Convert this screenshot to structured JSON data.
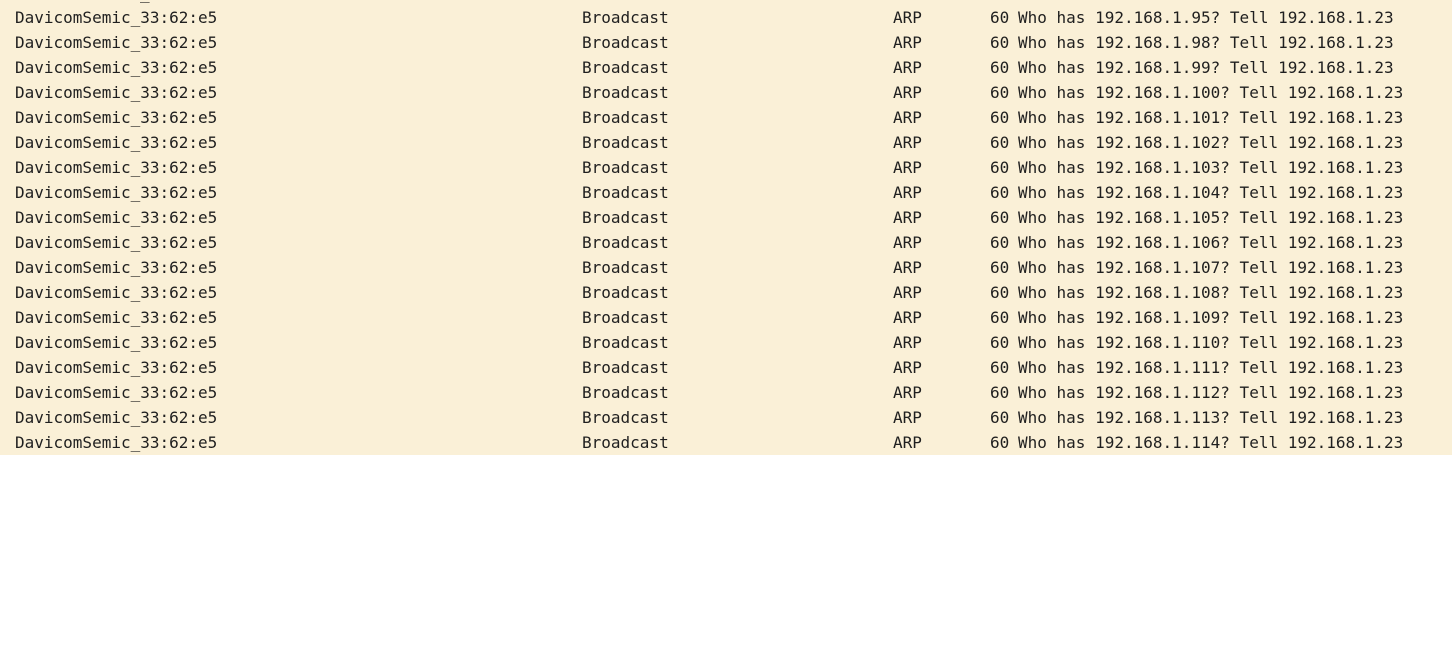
{
  "colors": {
    "arp_row_bg": "#faf0d7",
    "text": "#1f1f1f",
    "page_bg": "#ffffff"
  },
  "top_partial_glyph": "_",
  "packets": [
    {
      "source": "DavicomSemic_33:62:e5",
      "destination": "Broadcast",
      "protocol": "ARP",
      "length": "60",
      "info": "Who has 192.168.1.95? Tell 192.168.1.23"
    },
    {
      "source": "DavicomSemic_33:62:e5",
      "destination": "Broadcast",
      "protocol": "ARP",
      "length": "60",
      "info": "Who has 192.168.1.98? Tell 192.168.1.23"
    },
    {
      "source": "DavicomSemic_33:62:e5",
      "destination": "Broadcast",
      "protocol": "ARP",
      "length": "60",
      "info": "Who has 192.168.1.99? Tell 192.168.1.23"
    },
    {
      "source": "DavicomSemic_33:62:e5",
      "destination": "Broadcast",
      "protocol": "ARP",
      "length": "60",
      "info": "Who has 192.168.1.100? Tell 192.168.1.23"
    },
    {
      "source": "DavicomSemic_33:62:e5",
      "destination": "Broadcast",
      "protocol": "ARP",
      "length": "60",
      "info": "Who has 192.168.1.101? Tell 192.168.1.23"
    },
    {
      "source": "DavicomSemic_33:62:e5",
      "destination": "Broadcast",
      "protocol": "ARP",
      "length": "60",
      "info": "Who has 192.168.1.102? Tell 192.168.1.23"
    },
    {
      "source": "DavicomSemic_33:62:e5",
      "destination": "Broadcast",
      "protocol": "ARP",
      "length": "60",
      "info": "Who has 192.168.1.103? Tell 192.168.1.23"
    },
    {
      "source": "DavicomSemic_33:62:e5",
      "destination": "Broadcast",
      "protocol": "ARP",
      "length": "60",
      "info": "Who has 192.168.1.104? Tell 192.168.1.23"
    },
    {
      "source": "DavicomSemic_33:62:e5",
      "destination": "Broadcast",
      "protocol": "ARP",
      "length": "60",
      "info": "Who has 192.168.1.105? Tell 192.168.1.23"
    },
    {
      "source": "DavicomSemic_33:62:e5",
      "destination": "Broadcast",
      "protocol": "ARP",
      "length": "60",
      "info": "Who has 192.168.1.106? Tell 192.168.1.23"
    },
    {
      "source": "DavicomSemic_33:62:e5",
      "destination": "Broadcast",
      "protocol": "ARP",
      "length": "60",
      "info": "Who has 192.168.1.107? Tell 192.168.1.23"
    },
    {
      "source": "DavicomSemic_33:62:e5",
      "destination": "Broadcast",
      "protocol": "ARP",
      "length": "60",
      "info": "Who has 192.168.1.108? Tell 192.168.1.23"
    },
    {
      "source": "DavicomSemic_33:62:e5",
      "destination": "Broadcast",
      "protocol": "ARP",
      "length": "60",
      "info": "Who has 192.168.1.109? Tell 192.168.1.23"
    },
    {
      "source": "DavicomSemic_33:62:e5",
      "destination": "Broadcast",
      "protocol": "ARP",
      "length": "60",
      "info": "Who has 192.168.1.110? Tell 192.168.1.23"
    },
    {
      "source": "DavicomSemic_33:62:e5",
      "destination": "Broadcast",
      "protocol": "ARP",
      "length": "60",
      "info": "Who has 192.168.1.111? Tell 192.168.1.23"
    },
    {
      "source": "DavicomSemic_33:62:e5",
      "destination": "Broadcast",
      "protocol": "ARP",
      "length": "60",
      "info": "Who has 192.168.1.112? Tell 192.168.1.23"
    },
    {
      "source": "DavicomSemic_33:62:e5",
      "destination": "Broadcast",
      "protocol": "ARP",
      "length": "60",
      "info": "Who has 192.168.1.113? Tell 192.168.1.23"
    },
    {
      "source": "DavicomSemic_33:62:e5",
      "destination": "Broadcast",
      "protocol": "ARP",
      "length": "60",
      "info": "Who has 192.168.1.114? Tell 192.168.1.23"
    }
  ]
}
